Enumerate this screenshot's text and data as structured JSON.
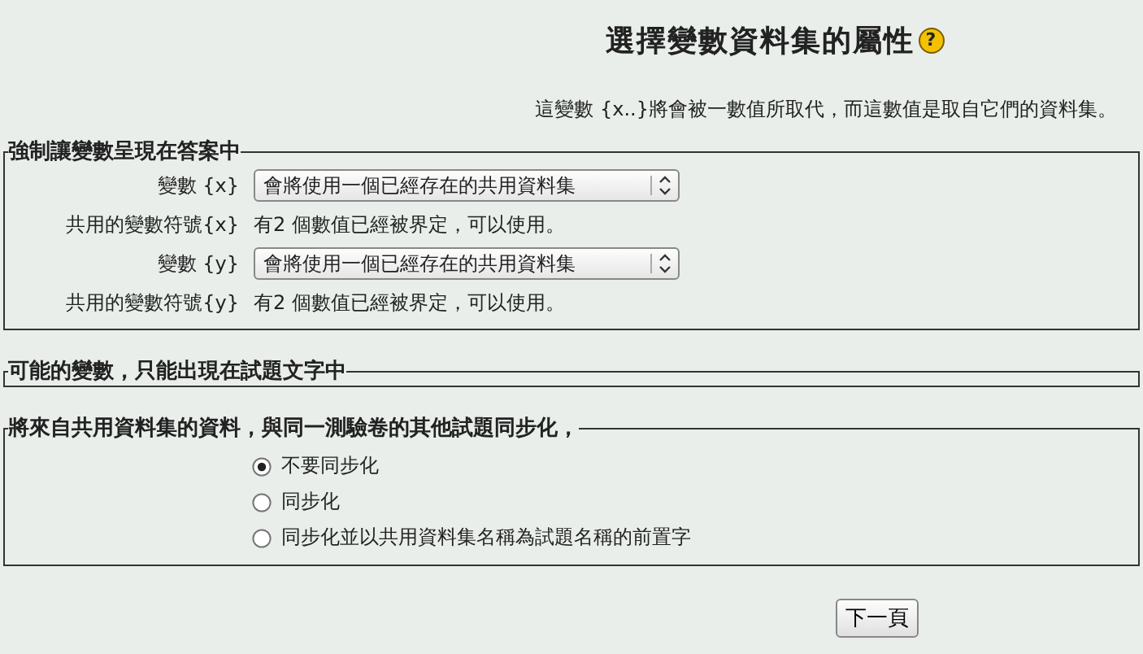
{
  "title": "選擇變數資料集的屬性",
  "help_mark": "?",
  "intro": "這變數 {x..}將會被一數值所取代，而這數值是取自它們的資料集。",
  "forced_section": {
    "legend": "強制讓變數呈現在答案中",
    "variables": [
      {
        "label": "變數 {x}",
        "select_value": "會將使用一個已經存在的共用資料集",
        "info_label": "共用的變數符號{x}",
        "info": "有2 個數值已經被界定，可以使用。"
      },
      {
        "label": "變數 {y}",
        "select_value": "會將使用一個已經存在的共用資料集",
        "info_label": "共用的變數符號{y}",
        "info": "有2 個數值已經被界定，可以使用。"
      }
    ]
  },
  "possible_section": {
    "legend": "可能的變數，只能出現在試題文字中"
  },
  "sync_section": {
    "legend": "將來自共用資料集的資料，與同一測驗卷的其他試題同步化，",
    "options": [
      {
        "label": "不要同步化",
        "selected": true
      },
      {
        "label": "同步化",
        "selected": false
      },
      {
        "label": "同步化並以共用資料集名稱為試題名稱的前置字",
        "selected": false
      }
    ]
  },
  "next_button": "下一頁"
}
